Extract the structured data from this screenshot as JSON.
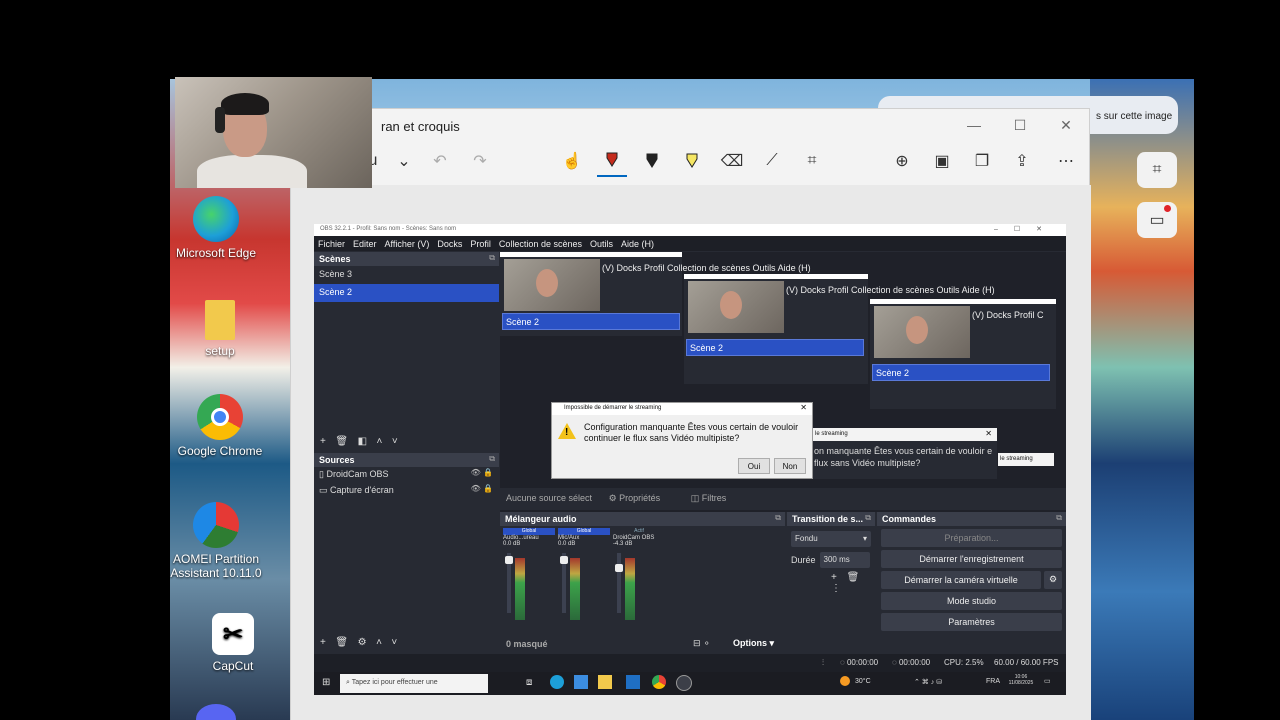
{
  "desktop": {
    "icons": [
      {
        "label": "Microsoft Edge",
        "icon": "edge-icon",
        "color": "#1d9fd8"
      },
      {
        "label": "setup",
        "icon": "setup-icon",
        "color": "#f2c94c"
      },
      {
        "label": "Google Chrome",
        "icon": "chrome-icon",
        "color": "#e84235"
      },
      {
        "label": "AOMEI Partition Assistant 10.11.0",
        "icon": "aomei-icon",
        "color": "#2e7d32"
      },
      {
        "label": "CapCut",
        "icon": "capcut-icon",
        "color": "#ffffff"
      }
    ]
  },
  "snipping_tool": {
    "title": "ran et croquis",
    "toolbar_letter": "u",
    "image_search_label": "s sur cette image",
    "accent_color": "#c42b1c"
  },
  "webcam": {
    "watermark": " "
  },
  "obs": {
    "window_title": "OBS 32.2.1 - Profil: Sans nom - Scènes: Sans nom",
    "menu": [
      "Fichier",
      "Editer",
      "Afficher (V)",
      "Docks",
      "Profil",
      "Collection de scènes",
      "Outils",
      "Aide (H)"
    ],
    "scenes_header": "Scènes",
    "scenes": [
      "Scène 3",
      "Scène 2"
    ],
    "selected_scene": "Scène 2",
    "recursive_menus": [
      "(V)  Docks  Profil  Collection de scènes  Outils  Aide (H)",
      "(V)  Docks  Profil  Collection de scènes  Outils  Aide (H)",
      "(V)  Docks  Profil  C"
    ],
    "sources_header": "Sources",
    "sources": [
      "DroidCam OBS",
      "Capture d'écran"
    ],
    "no_source": "Aucune source sélect",
    "properties": "Propriétés",
    "filters": "Filtres",
    "mixer_header": "Mélangeur audio",
    "channels": [
      {
        "tag": "Global",
        "name": "Audio...ureau",
        "db": "0.0 dB"
      },
      {
        "tag": "Global",
        "name": "Mic/Aux",
        "db": "0.0 dB"
      },
      {
        "tag": "Actif",
        "name": "DroidCam OBS",
        "db": "-4.3 dB"
      }
    ],
    "hidden_count": "0 masqué",
    "options": "Options",
    "transition_header": "Transition de s...",
    "transition_value": "Fondu",
    "duration_label": "Durée",
    "duration_value": "300 ms",
    "commands_header": "Commandes",
    "commands": [
      "Préparation...",
      "Démarrer l'enregistrement",
      "Démarrer la caméra virtuelle",
      "Mode studio",
      "Paramètres"
    ],
    "status": {
      "time1": "00:00:00",
      "time2": "00:00:00",
      "cpu": "CPU: 2.5%",
      "fps": "60.00 / 60.00 FPS"
    },
    "dialog": {
      "title": "Impossible de démarrer le streaming",
      "message": "Configuration manquante Êtes vous certain de vouloir continuer le flux sans Vidéo multipiste?",
      "yes": "Oui",
      "no": "Non"
    },
    "ghost_dialog_title": "le streaming",
    "ghost_dialog_text": "on manquante Êtes vous certain de vouloir e flux sans Vidéo multipiste?",
    "ghost_dialog_title2": "le streaming",
    "taskbar": {
      "search": "Tapez ici pour effectuer une",
      "weather": "30°C",
      "lang": "FRA",
      "clock_time": "10:06",
      "clock_date": "11/08/2025"
    }
  }
}
